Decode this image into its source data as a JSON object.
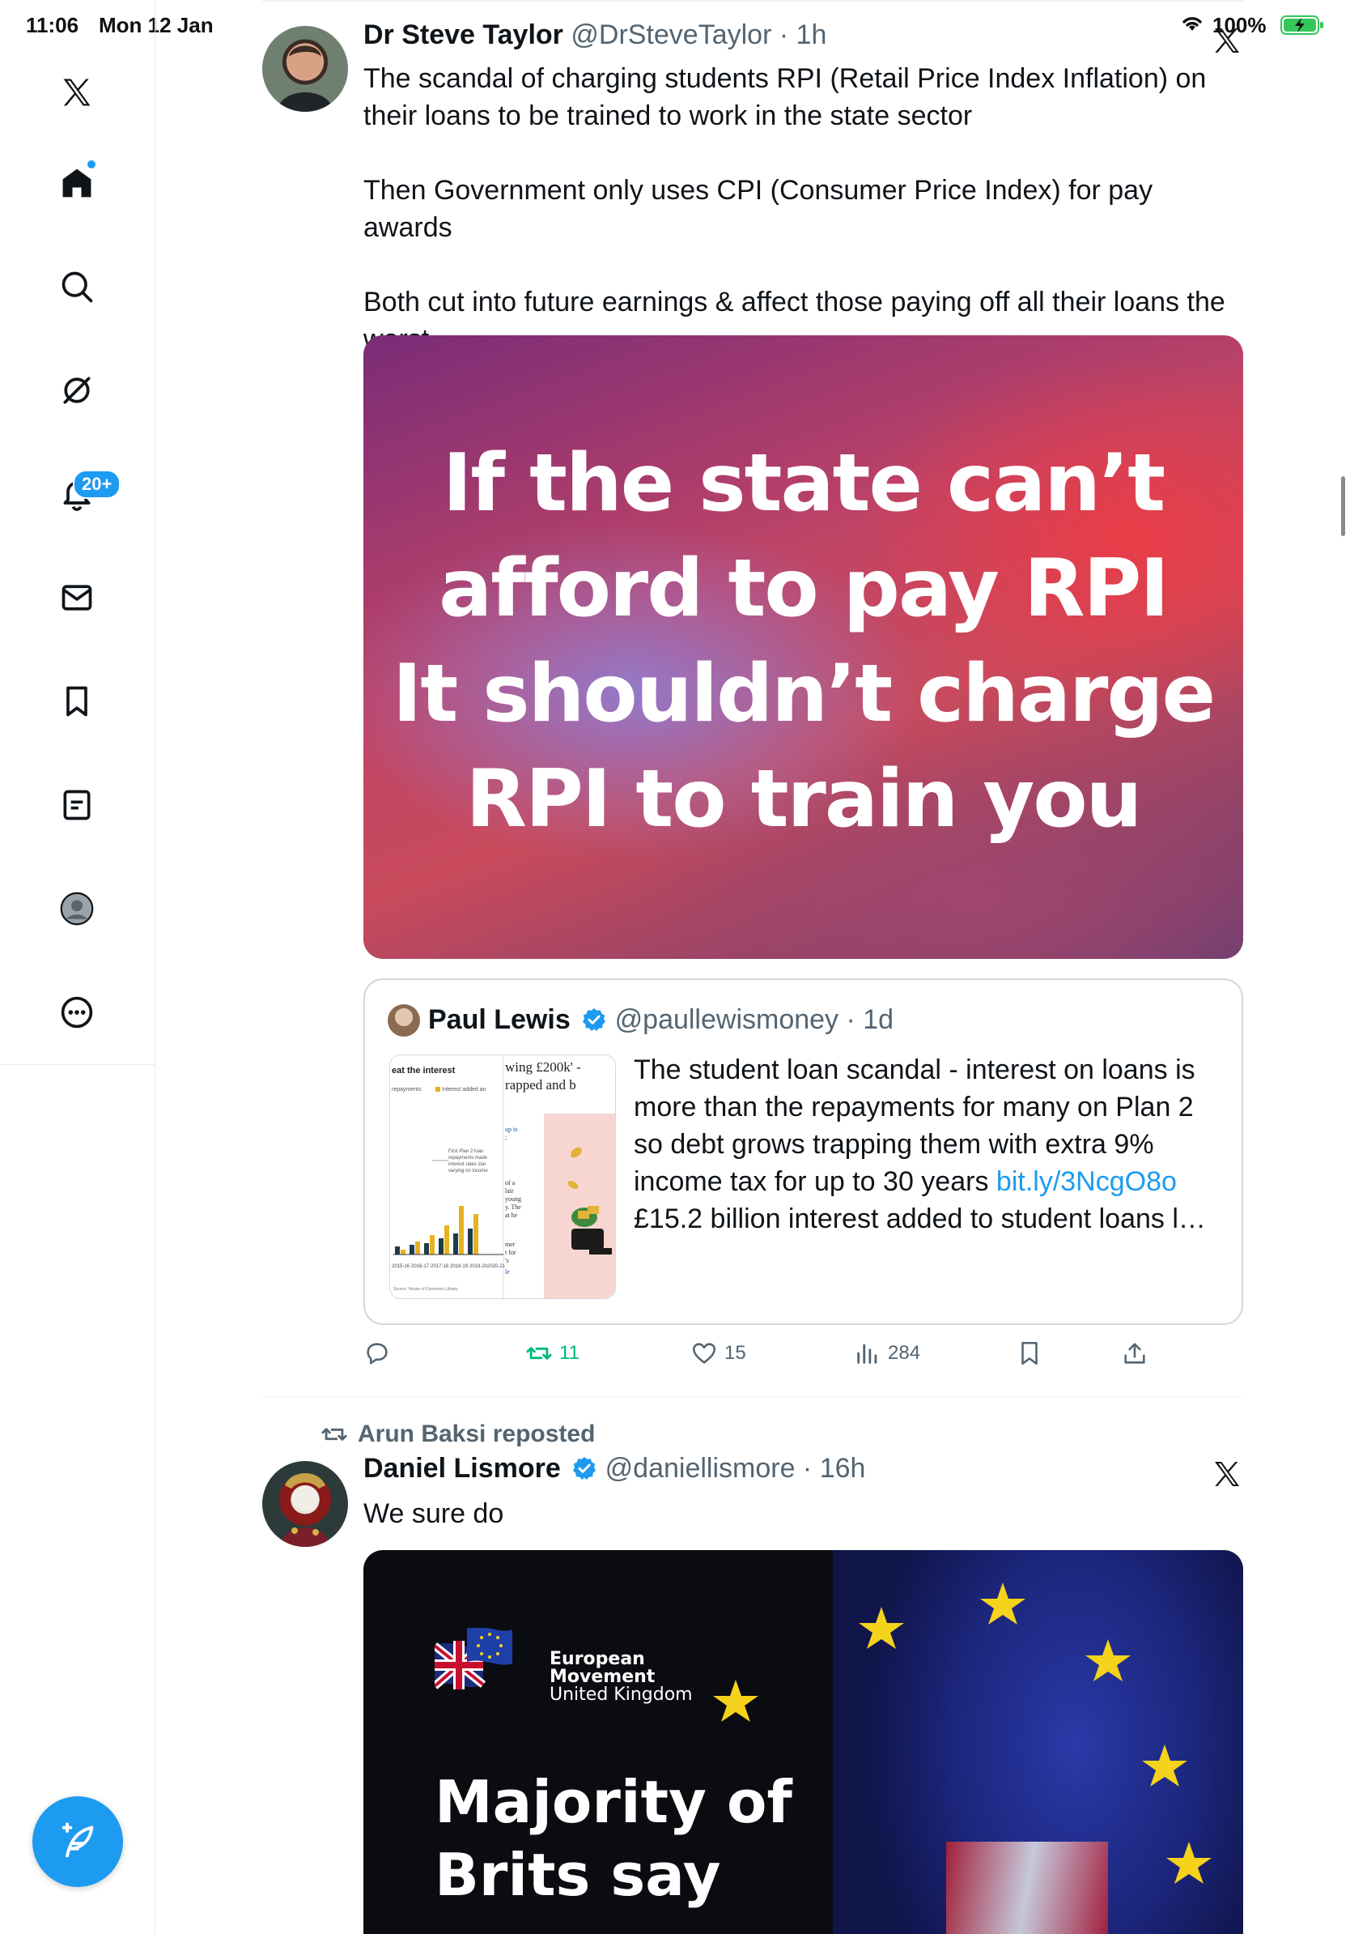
{
  "status_bar": {
    "time": "11:06",
    "date": "Mon 12 Jan",
    "battery_percent": "100%"
  },
  "sidebar": {
    "items": [
      {
        "name": "x-logo-icon"
      },
      {
        "name": "home-icon",
        "has_dot": true
      },
      {
        "name": "search-icon"
      },
      {
        "name": "grok-icon"
      },
      {
        "name": "notifications-icon",
        "badge": "20+"
      },
      {
        "name": "messages-icon"
      },
      {
        "name": "bookmarks-icon"
      },
      {
        "name": "lists-icon"
      },
      {
        "name": "profile-icon"
      },
      {
        "name": "more-icon"
      }
    ],
    "compose": "compose-icon"
  },
  "tweet1": {
    "author_name": "Dr Steve Taylor",
    "handle_time": "@DrSteveTaylor · 1h",
    "paragraphs": [
      "The scandal of charging students RPI (Retail Price Index Inflation) on their loans to be trained to work in the state sector",
      "Then Government only uses CPI (Consumer Price Index) for pay awards",
      "Both cut into future earnings & affect those paying off all their loans the worst"
    ],
    "image_caption_lines": [
      "If the state can’t",
      "afford to pay RPI",
      "It shouldn’t charge",
      "RPI to train you"
    ],
    "quote": {
      "author_name": "Paul Lewis",
      "handle_time": "@paullewismoney · 1d",
      "text_before_link": "The student loan scandal - interest on loans is more than the repayments for many on Plan 2 so debt grows trapping them with extra 9% income tax for up to 30 years ",
      "link": "bit.ly/3NcgO8o",
      "text_after_link": "£15.2 billion interest added to student loans l…",
      "thumb": {
        "chart_title": "eat the interest",
        "legend_a": "repayments",
        "legend_b": "Interest added an",
        "note_lines": [
          "First Plan 2 loan",
          "repayments made",
          "interest rates star",
          "varying on income"
        ],
        "headline_lines": [
          "wing £200k' -",
          "rapped and b"
        ],
        "side_text_lines": [
          "up is",
          ";",
          "of a",
          "lair",
          "young",
          "y. The",
          "at he",
          "mer",
          "t for",
          "'s",
          "le"
        ],
        "year_labels": [
          "2015-16",
          "2016-17",
          "2017-18",
          "2018-19",
          "2019-20",
          "2020-21"
        ],
        "source": "Source: House of Commons Library"
      }
    },
    "actions": {
      "reply_count": "",
      "retweet_count": "11",
      "like_count": "15",
      "views_count": "284"
    }
  },
  "tweet2": {
    "repost_label": "Arun Baksi reposted",
    "author_name": "Daniel Lismore",
    "handle_time": "@daniellismore · 16h",
    "text": "We sure do",
    "image": {
      "org_line1": "European",
      "org_line2": "Movement",
      "org_line3": "United Kingdom",
      "headline_lines": [
        "Majority of",
        "Brits say"
      ]
    }
  },
  "colors": {
    "accent": "#1d9bf0",
    "retweet_green": "#00ba7c",
    "muted": "#536471"
  }
}
